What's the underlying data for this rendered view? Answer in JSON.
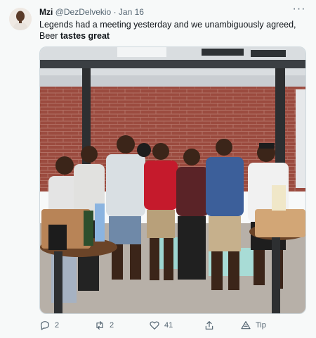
{
  "tweet": {
    "author_name": "Mzi",
    "handle": "@DezDelvekio",
    "separator": "·",
    "date": "Jan 16",
    "text_line1": "Legends had a meeting yesterday and we unambiguously agreed,",
    "text_line2_prefix": "Beer ",
    "text_line2_bold": "tastes great",
    "more_label": "···"
  },
  "actions": {
    "reply_count": "2",
    "retweet_count": "2",
    "like_count": "41",
    "tip_label": "Tip"
  },
  "icons": {
    "reply": "reply-icon",
    "retweet": "retweet-icon",
    "like": "heart-icon",
    "share": "share-icon",
    "tip": "tip-icon"
  },
  "colors": {
    "background": "#f7f9f9",
    "text_primary": "#0f1419",
    "text_secondary": "#536471",
    "border": "#cfd9de"
  }
}
